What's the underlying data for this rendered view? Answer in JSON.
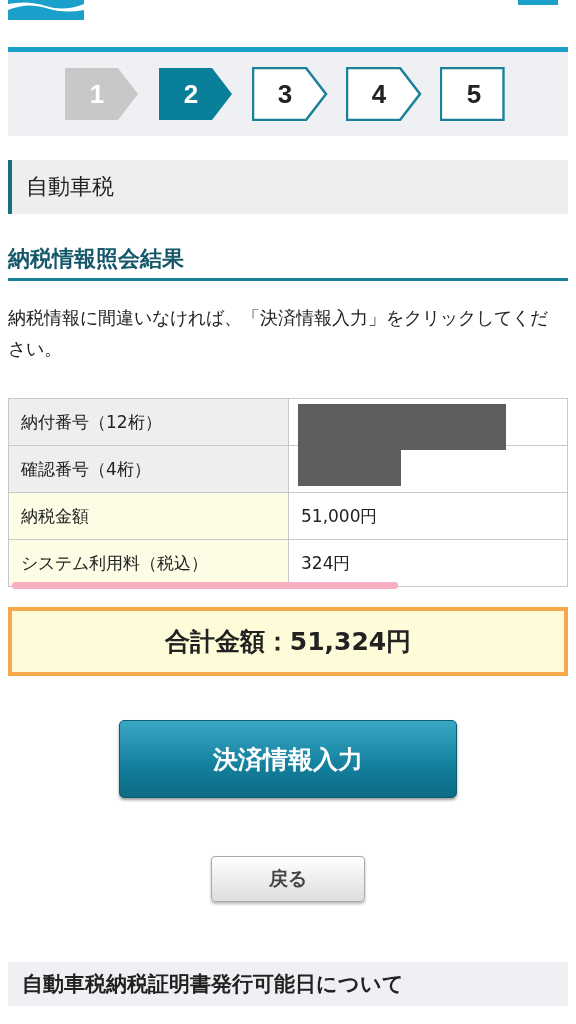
{
  "steps": [
    {
      "label": "1",
      "completed": true,
      "selected": false
    },
    {
      "label": "2",
      "completed": false,
      "selected": true
    },
    {
      "label": "3",
      "completed": false,
      "selected": false
    },
    {
      "label": "4",
      "completed": false,
      "selected": false
    },
    {
      "label": "5",
      "completed": false,
      "selected": false
    }
  ],
  "section_title": "自動車税",
  "heading": "納税情報照会結果",
  "instruction": "納税情報に間違いなければ、「決済情報入力」をクリックしてください。",
  "table": {
    "rows": [
      {
        "label": "納付番号（12桁）",
        "highlighted": false,
        "kind": "redacted"
      },
      {
        "label": "確認番号（4桁）",
        "highlighted": false,
        "kind": "redacted"
      },
      {
        "label": "納税金額",
        "highlighted": true,
        "kind": "text",
        "value": "51,000円"
      },
      {
        "label": "システム利用料（税込）",
        "highlighted": true,
        "kind": "text",
        "value": "324円",
        "marked": true
      }
    ]
  },
  "total": "合計金額：51,324円",
  "primary_button": "決済情報入力",
  "back_button": "戻る",
  "notice_heading": "自動車税納税証明書発行可能日について"
}
